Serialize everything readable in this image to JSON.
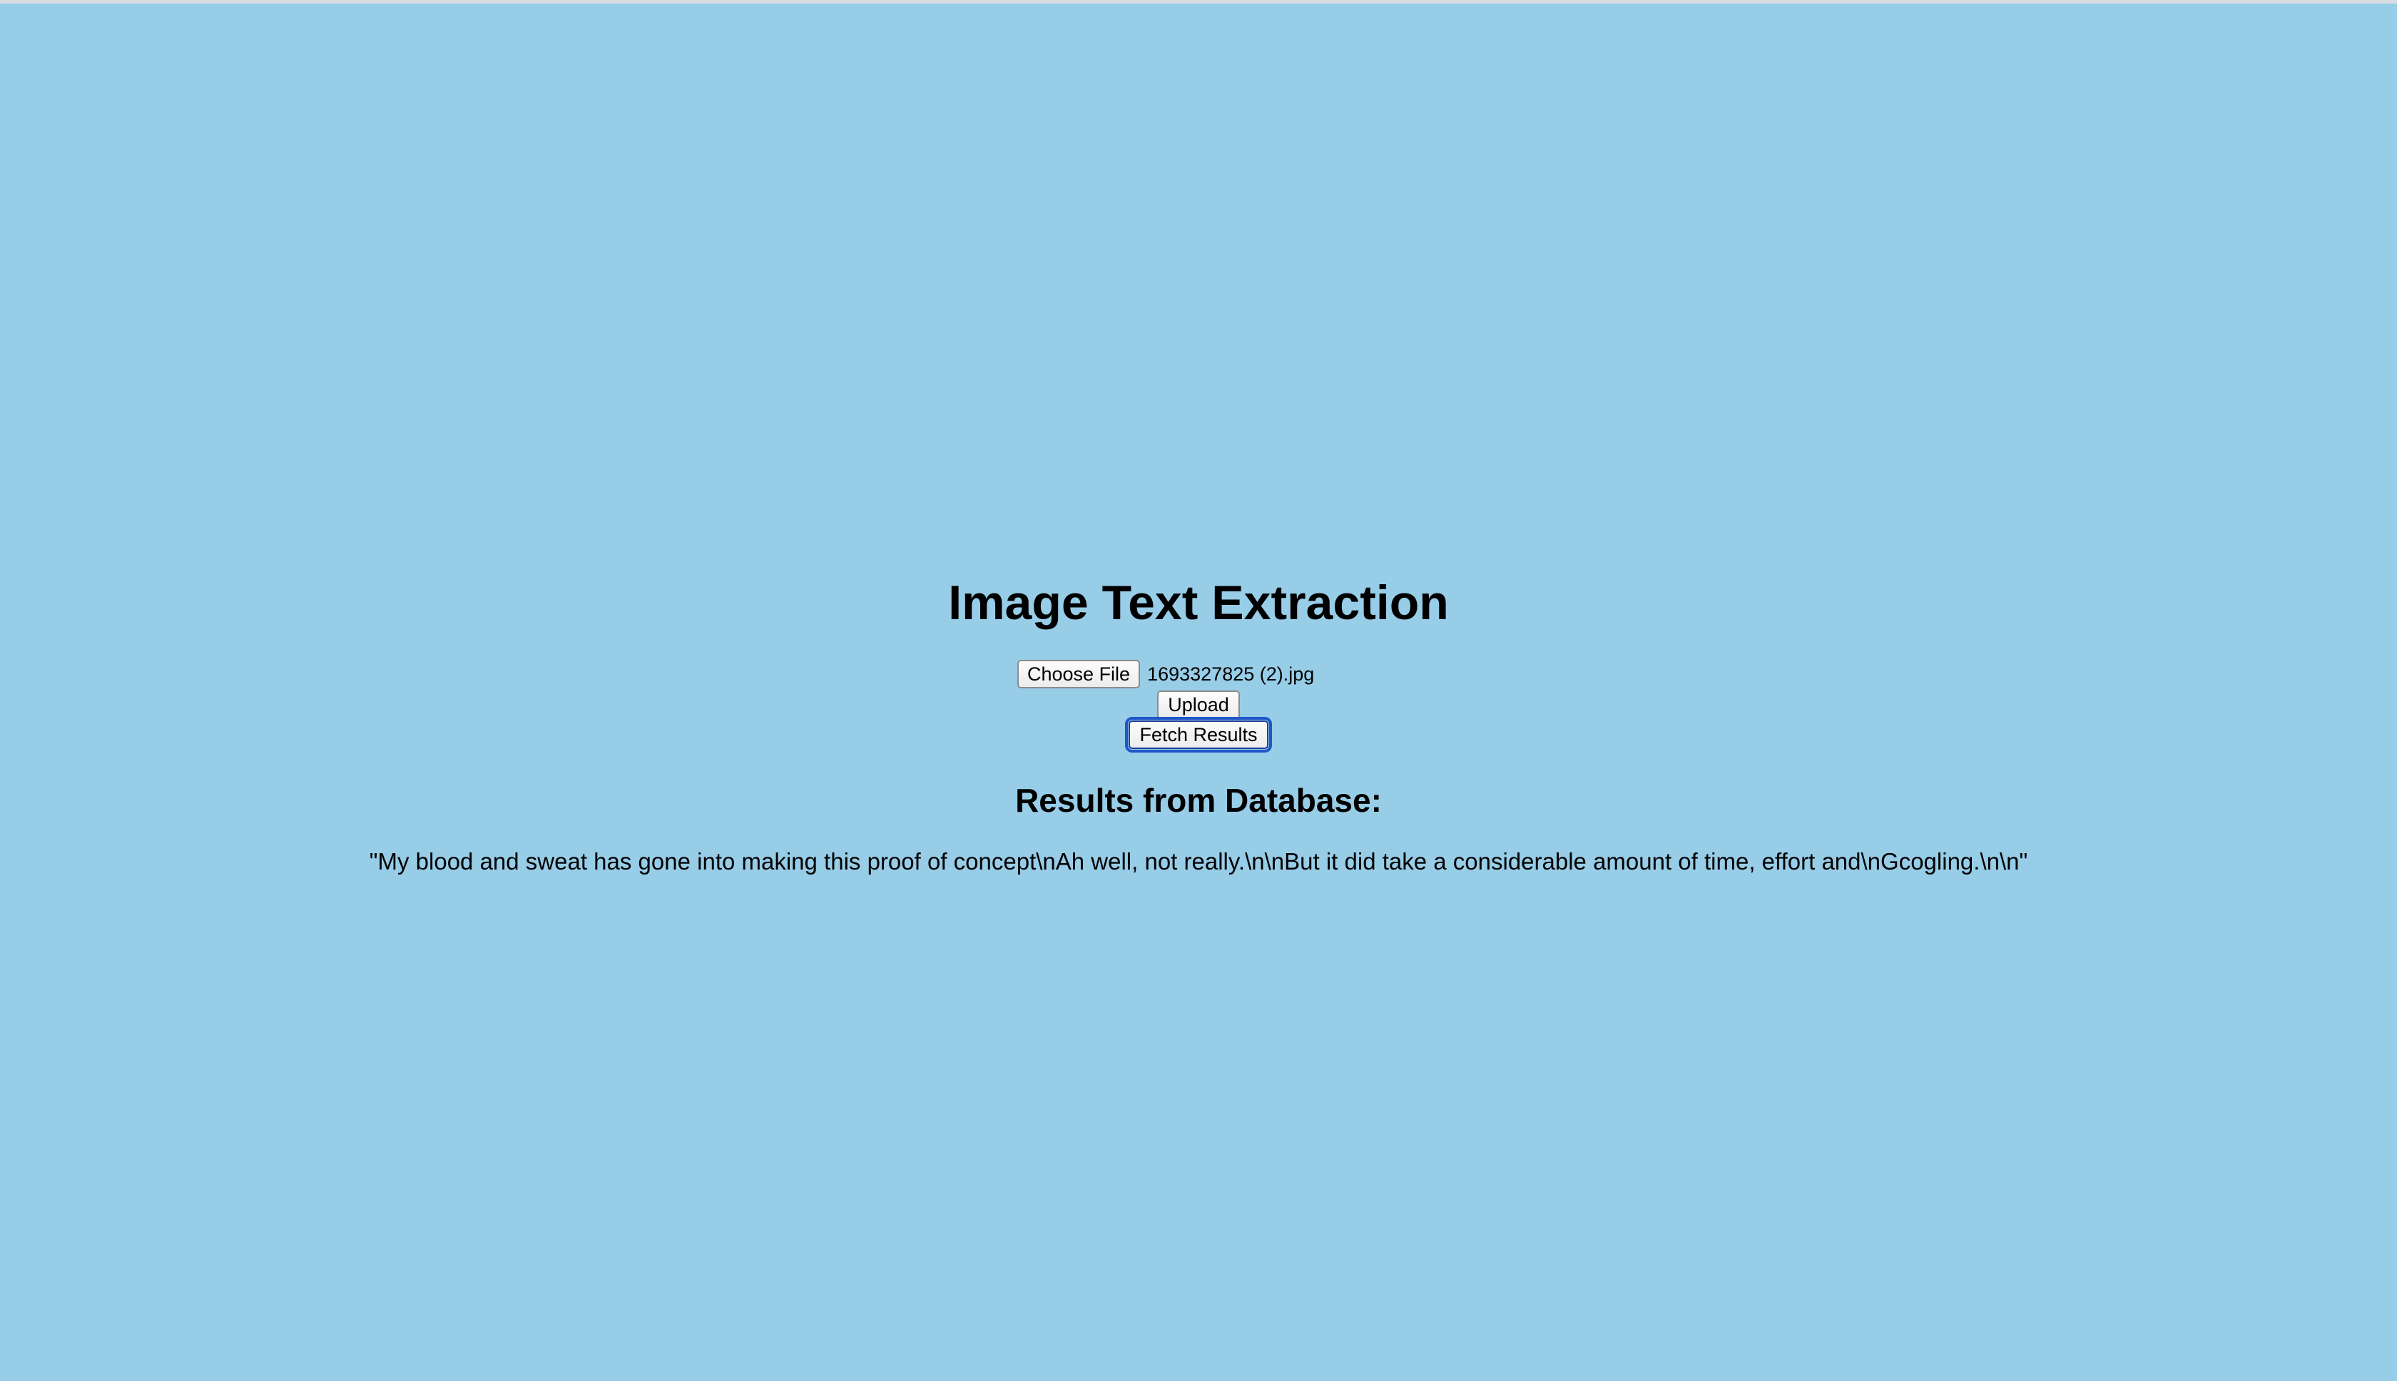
{
  "page": {
    "title": "Image Text Extraction",
    "background_color": "#98cde8"
  },
  "upload_form": {
    "choose_file_label": "Choose File",
    "selected_file_name": "1693327825 (2).jpg",
    "upload_label": "Upload",
    "fetch_label": "Fetch Results"
  },
  "results": {
    "heading": "Results from Database:",
    "text": "\"My blood and sweat has gone into making this proof of concept\\nAh well, not really.\\n\\nBut it did take a considerable amount of time, effort and\\nGcogling.\\n\\n\""
  }
}
